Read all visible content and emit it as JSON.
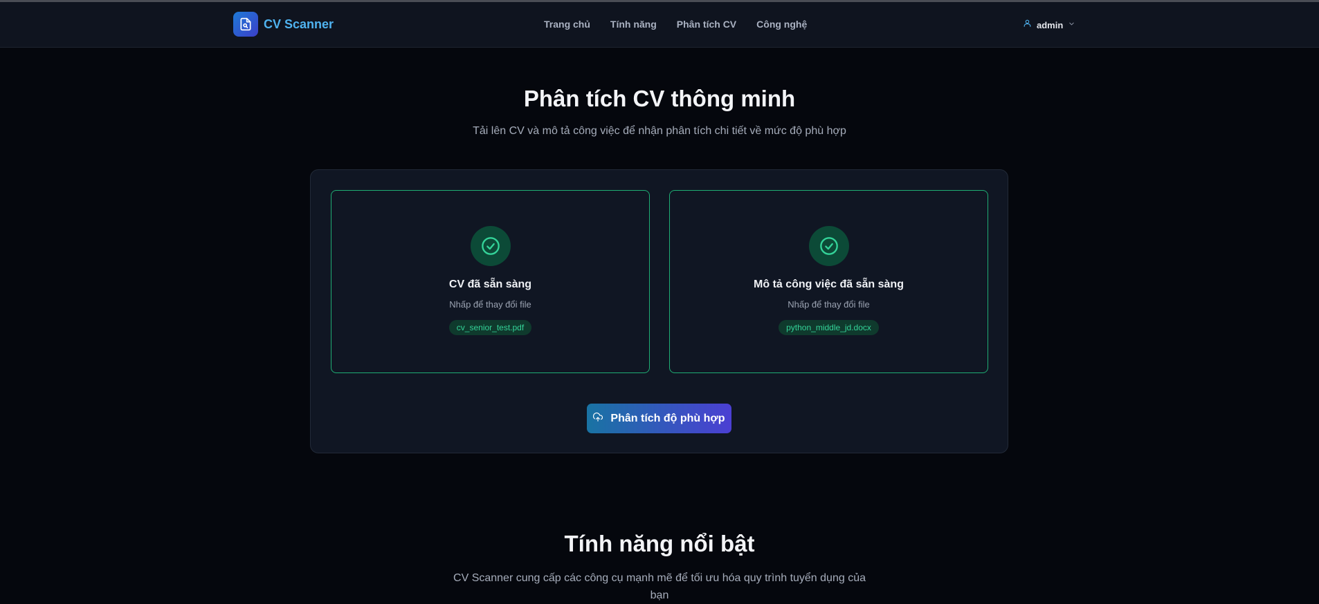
{
  "navbar": {
    "brand_name": "CV Scanner",
    "links": [
      "Trang chủ",
      "Tính năng",
      "Phân tích CV",
      "Công nghệ"
    ],
    "user": "admin"
  },
  "hero": {
    "title": "Phân tích CV thông minh",
    "subtitle": "Tải lên CV và mô tả công việc để nhận phân tích chi tiết về mức độ phù hợp"
  },
  "upload": {
    "cv_card": {
      "title": "CV đã sẵn sàng",
      "hint": "Nhấp để thay đổi file",
      "file_name": "cv_senior_test.pdf"
    },
    "jd_card": {
      "title": "Mô tả công việc đã sẵn sàng",
      "hint": "Nhấp để thay đổi file",
      "file_name": "python_middle_jd.docx"
    },
    "analyze_label": "Phân tích độ phù hợp"
  },
  "features": {
    "title": "Tính năng nổi bật",
    "subtitle": "CV Scanner cung cấp các công cụ mạnh mẽ để tối ưu hóa quy trình tuyển dụng của bạn"
  },
  "colors": {
    "accent_green": "#34d399",
    "brand_blue": "#4fb3f0",
    "button_gradient_start": "#1973a3",
    "button_gradient_end": "#4b3fd3"
  }
}
